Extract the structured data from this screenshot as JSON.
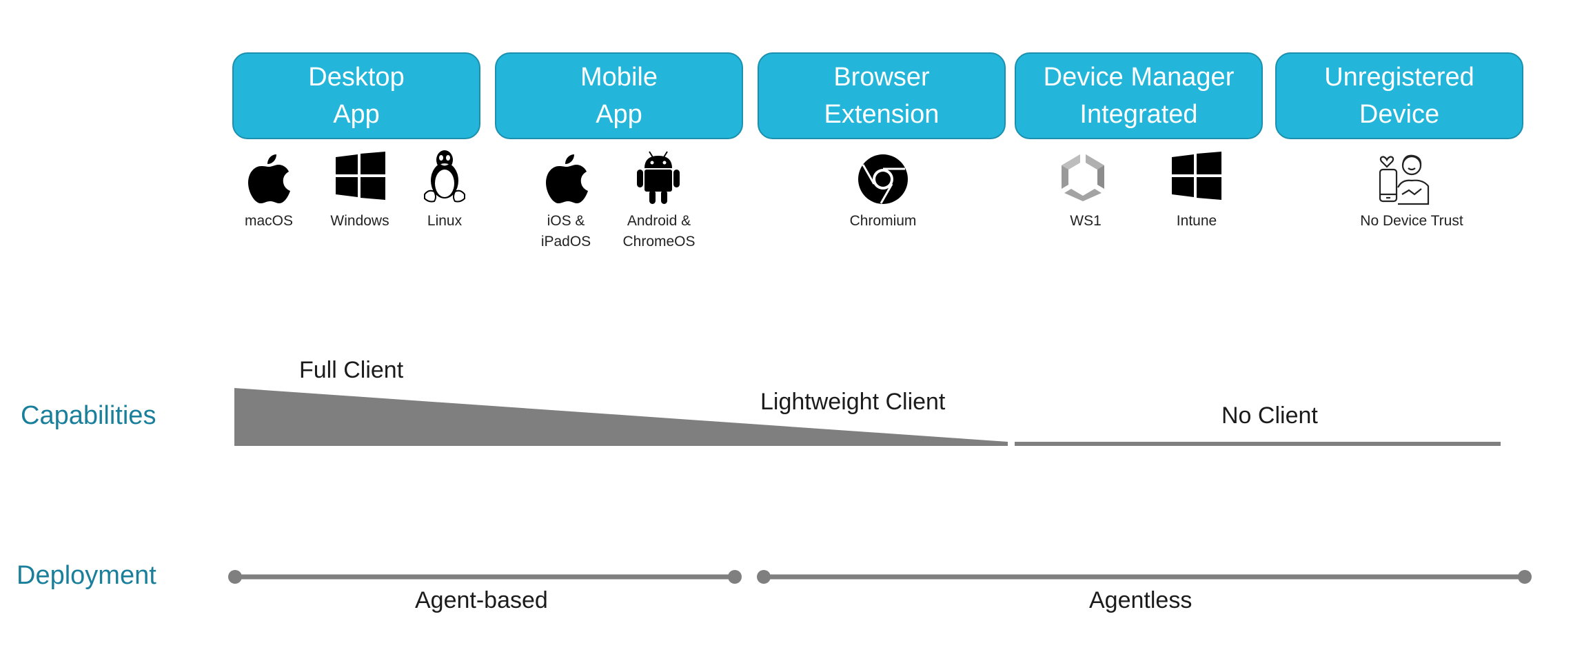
{
  "colors": {
    "box_fill": "#24b6da",
    "box_border": "#1a90ae",
    "row_label": "#1a7f9a",
    "bar_gray": "#7f7f7f"
  },
  "categories": [
    {
      "line1": "Desktop",
      "line2": "App"
    },
    {
      "line1": "Mobile",
      "line2": "App"
    },
    {
      "line1": "Browser",
      "line2": "Extension"
    },
    {
      "line1": "Device Manager",
      "line2": "Integrated"
    },
    {
      "line1": "Unregistered",
      "line2": "Device"
    }
  ],
  "platforms": [
    {
      "icon": "apple-icon",
      "line1": "macOS",
      "line2": ""
    },
    {
      "icon": "windows-icon",
      "line1": "Windows",
      "line2": ""
    },
    {
      "icon": "linux-icon",
      "line1": "Linux",
      "line2": ""
    },
    {
      "icon": "apple-icon",
      "line1": "iOS &",
      "line2": "iPadOS"
    },
    {
      "icon": "android-icon",
      "line1": "Android &",
      "line2": "ChromeOS"
    },
    {
      "icon": "chromium-icon",
      "line1": "Chromium",
      "line2": ""
    },
    {
      "icon": "ws1-icon",
      "line1": "WS1",
      "line2": ""
    },
    {
      "icon": "windows-icon",
      "line1": "Intune",
      "line2": ""
    },
    {
      "icon": "person-phone-icon",
      "line1": "No Device Trust",
      "line2": ""
    }
  ],
  "capabilities": {
    "row_label": "Capabilities",
    "full_client": "Full Client",
    "lightweight_client": "Lightweight Client",
    "no_client": "No Client"
  },
  "deployment": {
    "row_label": "Deployment",
    "agent_based": "Agent-based",
    "agentless": "Agentless"
  }
}
